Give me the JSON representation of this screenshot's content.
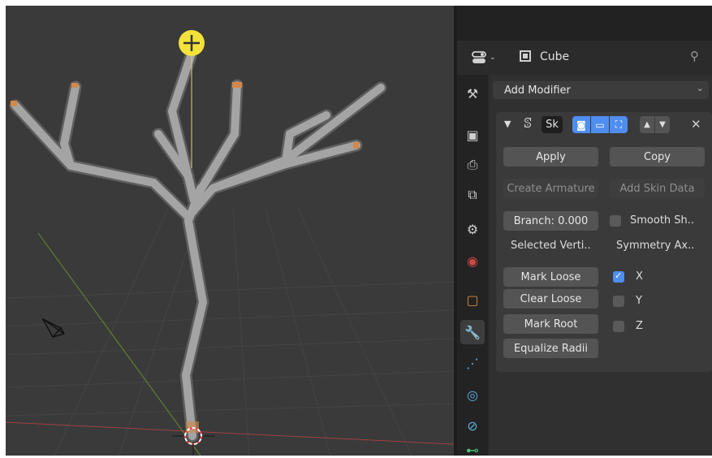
{
  "header": {
    "object_name": "Cube"
  },
  "add_modifier": {
    "label": "Add Modifier"
  },
  "modifier": {
    "name": "Sk",
    "apply_label": "Apply",
    "copy_label": "Copy",
    "create_armature_label": "Create Armature",
    "add_skin_data_label": "Add Skin Data",
    "branch_label": "Branch: 0.000",
    "smooth_shading_label": "Smooth Sh..",
    "smooth_shading_checked": false,
    "selected_vertices_label": "Selected Verti..",
    "symmetry_axes_label": "Symmetry Ax..",
    "mark_loose_label": "Mark Loose",
    "clear_loose_label": "Clear Loose",
    "mark_root_label": "Mark Root",
    "equalize_radii_label": "Equalize Radii",
    "axes": [
      {
        "label": "X",
        "checked": true
      },
      {
        "label": "Y",
        "checked": false
      },
      {
        "label": "Z",
        "checked": false
      }
    ]
  },
  "tabs": [
    {
      "name": "tool-icon",
      "active": false
    },
    {
      "name": "render-icon",
      "active": false
    },
    {
      "name": "output-icon",
      "active": false
    },
    {
      "name": "view-layer-icon",
      "active": false
    },
    {
      "name": "scene-icon",
      "active": false
    },
    {
      "name": "world-icon",
      "active": false
    },
    {
      "name": "object-icon",
      "active": false
    },
    {
      "name": "modifier-wrench-icon",
      "active": true
    },
    {
      "name": "particles-icon",
      "active": false
    },
    {
      "name": "physics-icon",
      "active": false
    },
    {
      "name": "constraints-icon",
      "active": false
    },
    {
      "name": "data-icon",
      "active": false
    }
  ],
  "colors": {
    "panel_bg": "#303030",
    "viewport_bg": "#3a3a3a",
    "accent_blue": "#4f8ef0",
    "tree_gray": "#9c9c9c",
    "tip_orange": "#d4884a",
    "cursor_yellow": "#f2e23a"
  }
}
